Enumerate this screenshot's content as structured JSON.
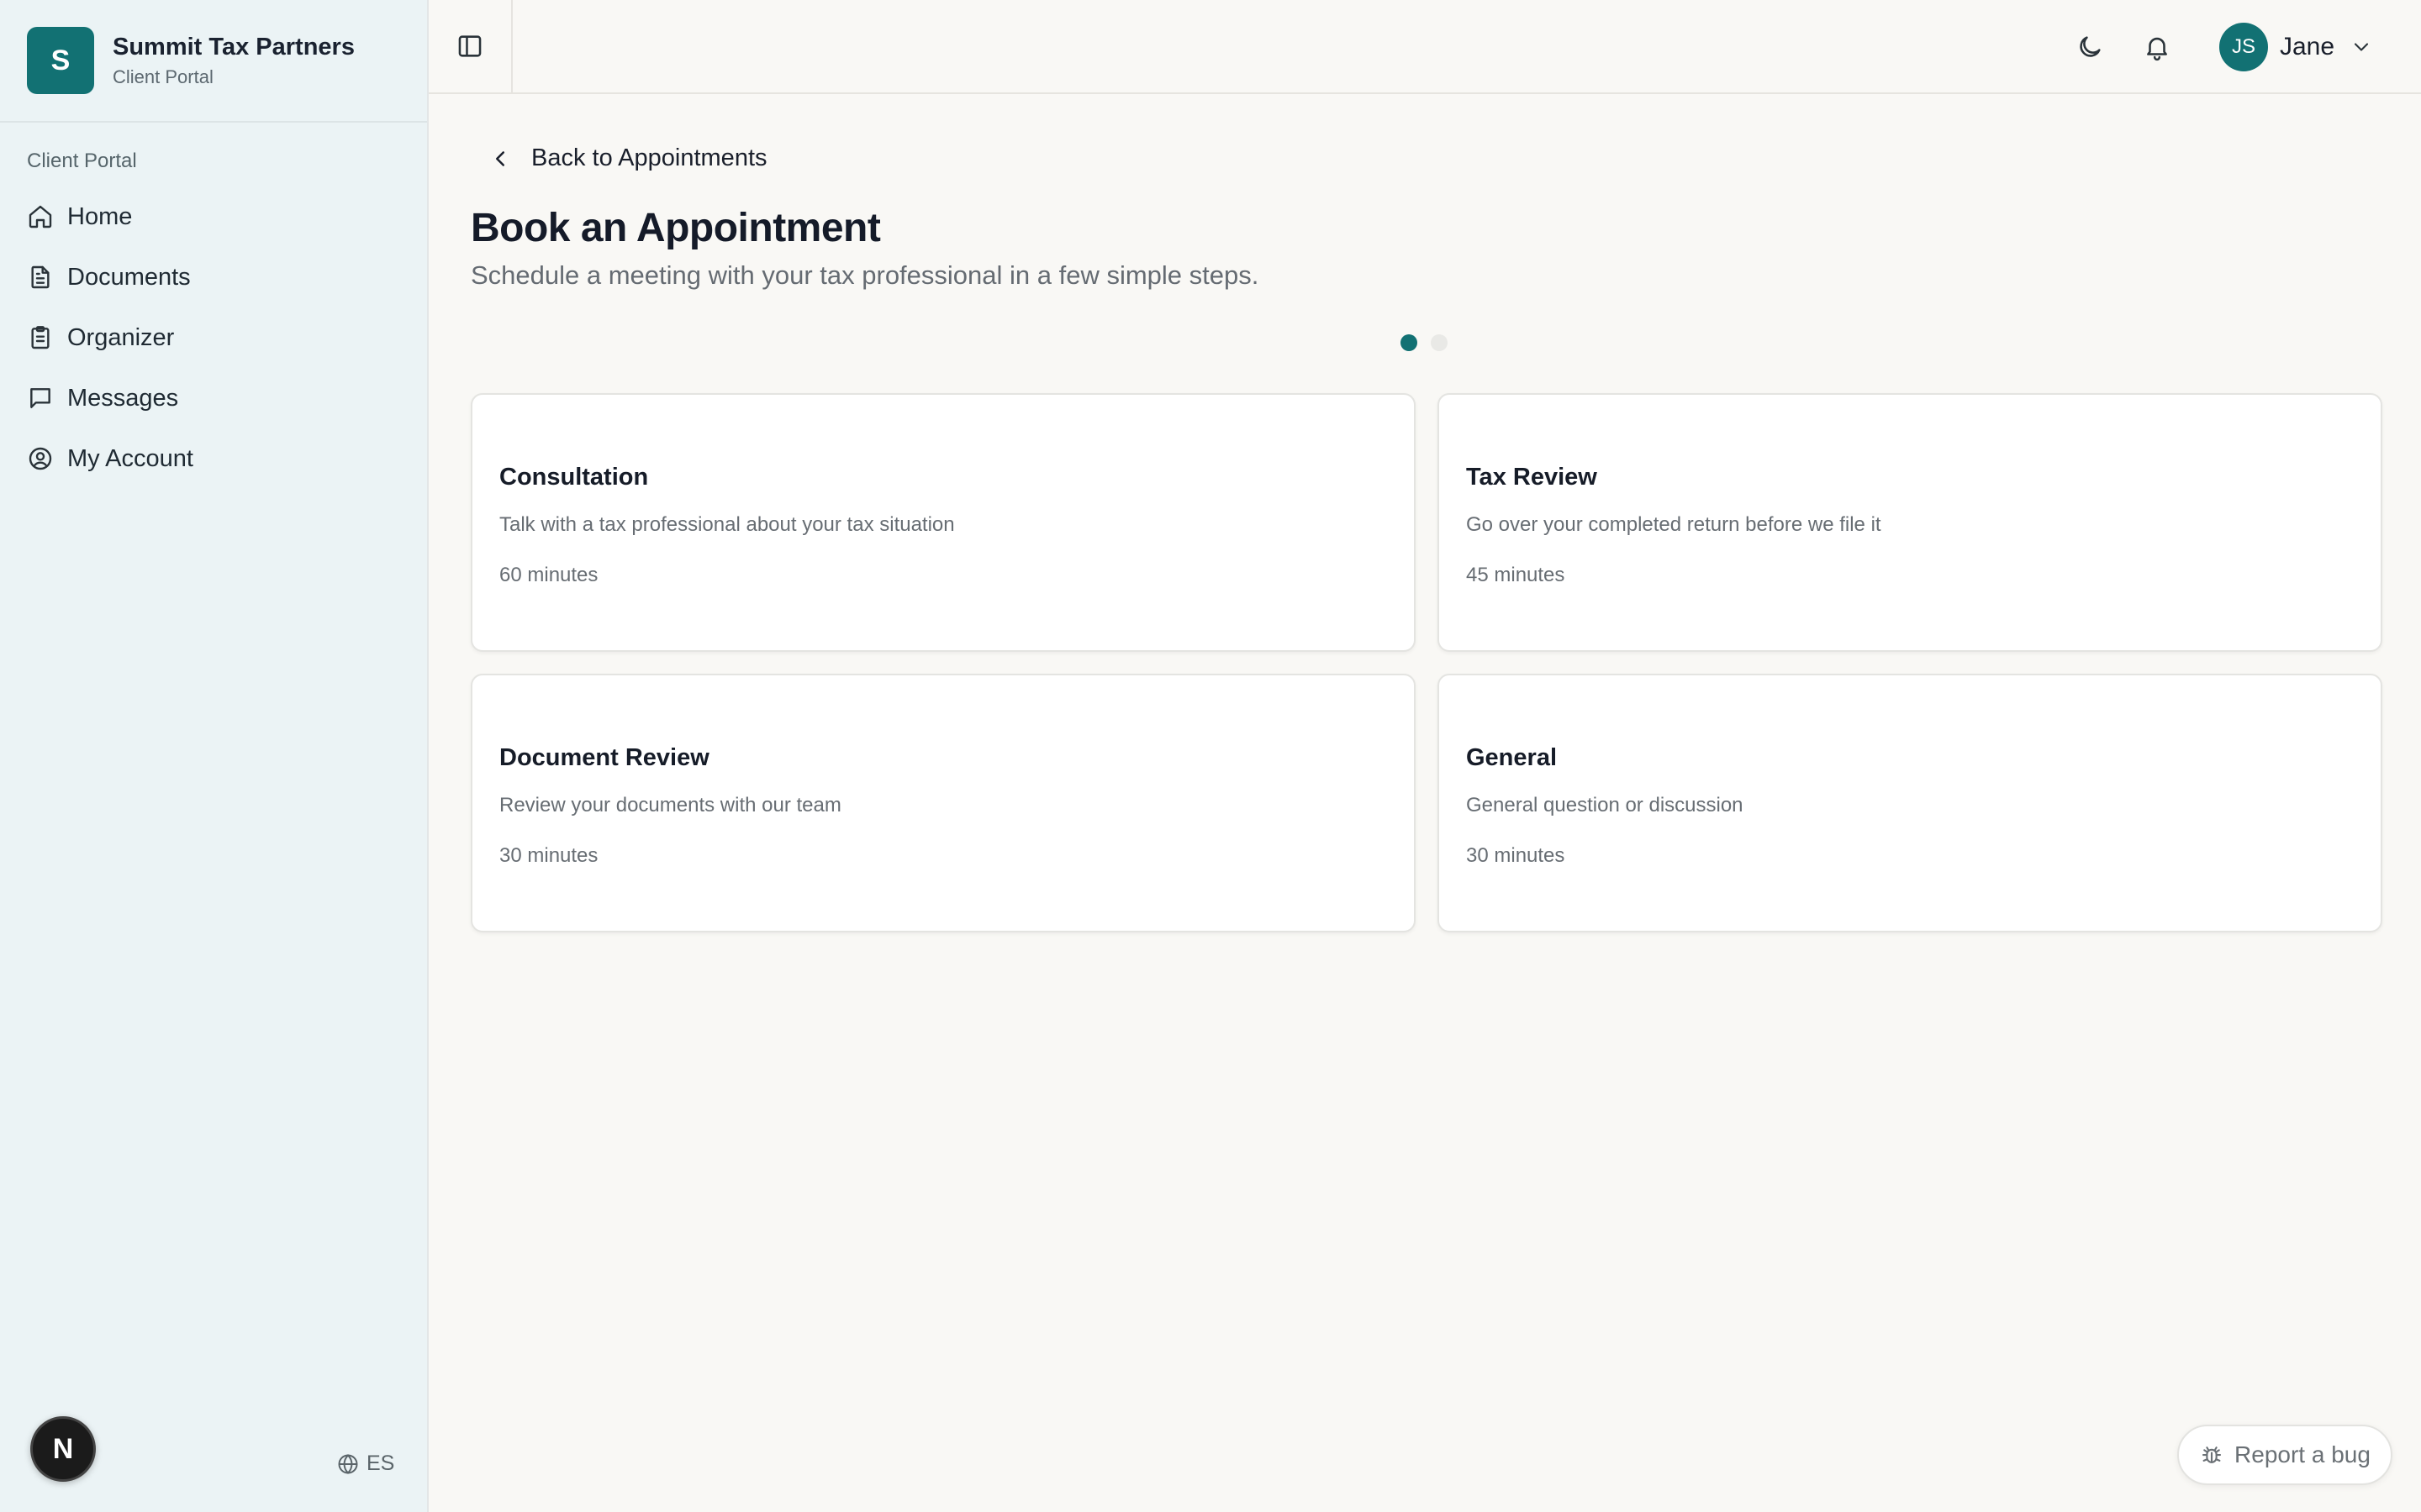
{
  "brand": {
    "logo_letter": "S",
    "name": "Summit Tax Partners",
    "subtitle": "Client Portal",
    "accent_color": "#127173"
  },
  "sidebar": {
    "section_label": "Client Portal",
    "items": [
      {
        "label": "Home",
        "icon": "home-icon"
      },
      {
        "label": "Documents",
        "icon": "file-text-icon"
      },
      {
        "label": "Organizer",
        "icon": "clipboard-icon"
      },
      {
        "label": "Messages",
        "icon": "message-square-icon"
      },
      {
        "label": "My Account",
        "icon": "user-circle-icon"
      }
    ],
    "dev_badge": "N",
    "language": "ES"
  },
  "header": {
    "user_initials": "JS",
    "user_name": "Jane"
  },
  "main": {
    "back_label": "Back to Appointments",
    "title": "Book an Appointment",
    "subtitle": "Schedule a meeting with your tax professional in a few simple steps.",
    "steps": {
      "total": 2,
      "current": 1,
      "active_color": "#127173",
      "inactive_color": "#e9e9e6"
    },
    "appointment_types": [
      {
        "title": "Consultation",
        "description": "Talk with a tax professional about your tax situation",
        "duration": "60 minutes"
      },
      {
        "title": "Tax Review",
        "description": "Go over your completed return before we file it",
        "duration": "45 minutes"
      },
      {
        "title": "Document Review",
        "description": "Review your documents with our team",
        "duration": "30 minutes"
      },
      {
        "title": "General",
        "description": "General question or discussion",
        "duration": "30 minutes"
      }
    ]
  },
  "report_bug_label": "Report a bug"
}
